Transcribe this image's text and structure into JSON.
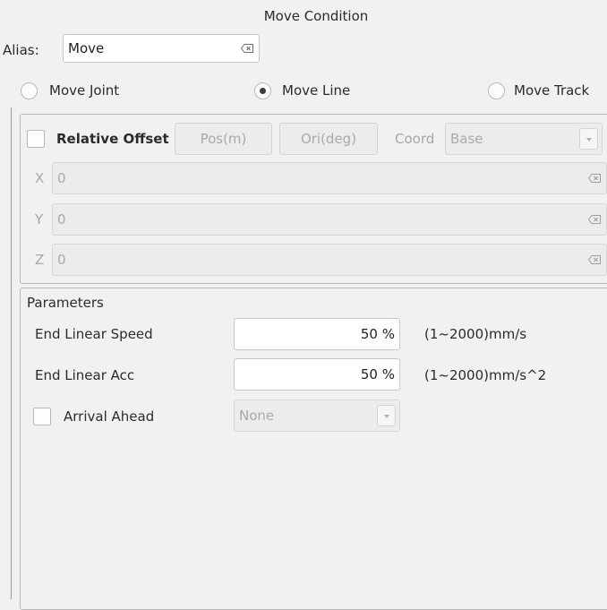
{
  "window": {
    "title": "Move Condition"
  },
  "alias": {
    "label": "Alias:",
    "value": "Move"
  },
  "move_type": {
    "options": [
      {
        "label": "Move Joint",
        "checked": false
      },
      {
        "label": "Move Line",
        "checked": true
      },
      {
        "label": "Move Track",
        "checked": false
      }
    ]
  },
  "offset": {
    "relative_label": "Relative Offset",
    "relative_checked": false,
    "pos_button": "Pos(m)",
    "ori_button": "Ori(deg)",
    "coord_label": "Coord",
    "coord_value": "Base",
    "fields": [
      {
        "label": "X",
        "value": "0"
      },
      {
        "label": "Y",
        "value": "0"
      },
      {
        "label": "Z",
        "value": "0"
      }
    ]
  },
  "parameters": {
    "title": "Parameters",
    "rows": [
      {
        "label": "End Linear Speed",
        "value": "50 %",
        "range": "(1~2000)mm/s"
      },
      {
        "label": "End Linear Acc",
        "value": "50 %",
        "range": "(1~2000)mm/s^2"
      }
    ],
    "arrival_label": "Arrival Ahead",
    "arrival_checked": false,
    "arrival_value": "None"
  }
}
